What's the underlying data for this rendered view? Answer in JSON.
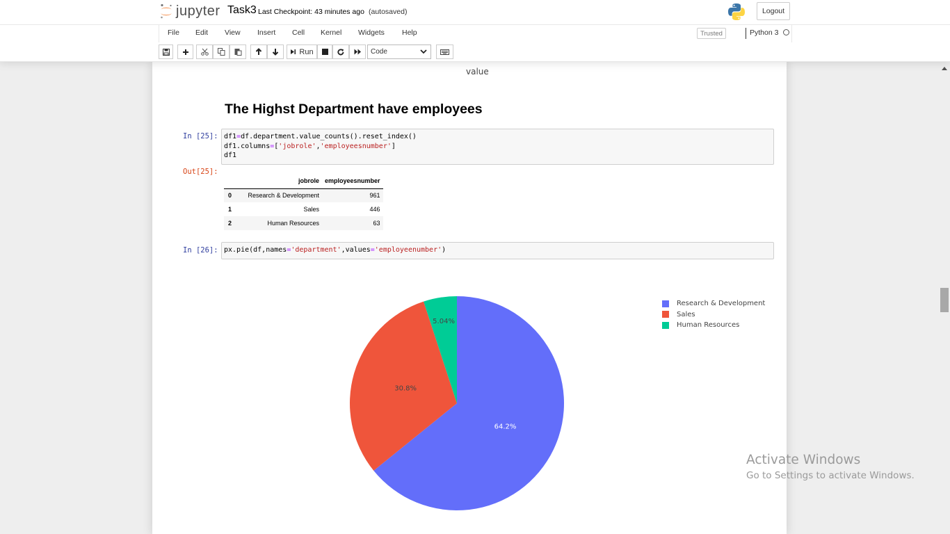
{
  "header": {
    "logo_text": "jupyter",
    "notebook_name": "Task3",
    "checkpoint": "Last Checkpoint: 43 minutes ago",
    "autosave": "(autosaved)",
    "logout_label": "Logout"
  },
  "menu": {
    "items": [
      "File",
      "Edit",
      "View",
      "Insert",
      "Cell",
      "Kernel",
      "Widgets",
      "Help"
    ],
    "trusted": "Trusted",
    "kernel_name": "Python 3"
  },
  "toolbar": {
    "run_label": "Run",
    "cell_type": "Code"
  },
  "notebook": {
    "prev_output_text": "value",
    "heading": "The Highst Department have employees",
    "cell25": {
      "in_prompt": "In [25]:",
      "out_prompt": "Out[25]:",
      "code_lines": [
        "df1=df.department.value_counts().reset_index()",
        "df1.columns=['jobrole','employeesnumber']",
        "df1"
      ],
      "table": {
        "columns": [
          "jobrole",
          "employeesnumber"
        ],
        "rows": [
          {
            "index": "0",
            "jobrole": "Research & Development",
            "employeesnumber": "961"
          },
          {
            "index": "1",
            "jobrole": "Sales",
            "employeesnumber": "446"
          },
          {
            "index": "2",
            "jobrole": "Human Resources",
            "employeesnumber": "63"
          }
        ]
      }
    },
    "cell26": {
      "in_prompt": "In [26]:",
      "code": "px.pie(df,names='department',values='employeenumber')"
    }
  },
  "chart_data": {
    "type": "pie",
    "slices": [
      {
        "name": "Research & Development",
        "value": 64.2,
        "label": "64.2%",
        "color": "#636efa"
      },
      {
        "name": "Sales",
        "value": 30.8,
        "label": "30.8%",
        "color": "#ef553b"
      },
      {
        "name": "Human Resources",
        "value": 5.04,
        "label": "5.04%",
        "color": "#00cc96"
      }
    ],
    "legend_position": "top-right"
  },
  "watermark": {
    "line1": "Activate Windows",
    "line2": "Go to Settings to activate Windows."
  }
}
